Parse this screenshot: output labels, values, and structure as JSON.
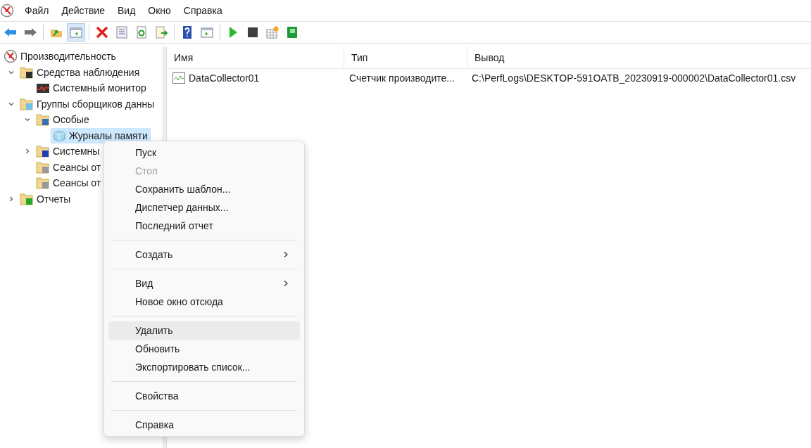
{
  "menu_bar": [
    "Файл",
    "Действие",
    "Вид",
    "Окно",
    "Справка"
  ],
  "toolbar": [
    [
      {
        "kind": "back",
        "disabled": false,
        "pressed": false
      },
      {
        "kind": "forward",
        "disabled": true,
        "pressed": false
      }
    ],
    [
      {
        "kind": "up",
        "disabled": false,
        "pressed": false
      },
      {
        "kind": "tree",
        "disabled": false,
        "pressed": true
      }
    ],
    [
      {
        "kind": "delete",
        "disabled": false,
        "pressed": false
      },
      {
        "kind": "properties",
        "disabled": false,
        "pressed": false
      },
      {
        "kind": "refresh",
        "disabled": false,
        "pressed": false
      },
      {
        "kind": "export",
        "disabled": false,
        "pressed": false
      }
    ],
    [
      {
        "kind": "help",
        "disabled": false,
        "pressed": false
      },
      {
        "kind": "pane",
        "disabled": false,
        "pressed": false
      }
    ],
    [
      {
        "kind": "play",
        "disabled": false,
        "pressed": false
      },
      {
        "kind": "stop",
        "disabled": true,
        "pressed": false
      },
      {
        "kind": "new",
        "disabled": false,
        "pressed": false
      },
      {
        "kind": "book",
        "disabled": false,
        "pressed": false
      }
    ]
  ],
  "tree": [
    {
      "label": "Производительность",
      "kind": "perf",
      "selected": false,
      "children": [
        {
          "label": "Средства наблюдения",
          "kind": "folder-monitor",
          "expanded": true,
          "selected": false,
          "children": [
            {
              "label": "Системный монитор",
              "kind": "monitor",
              "selected": false
            }
          ]
        },
        {
          "label": "Группы сборщиков данны",
          "kind": "folder-group",
          "expanded": true,
          "selected": false,
          "children": [
            {
              "label": "Особые",
              "kind": "folder-user",
              "expanded": true,
              "selected": false,
              "children": [
                {
                  "label": "Журналы памяти",
                  "kind": "cube",
                  "selected": true
                }
              ]
            },
            {
              "label": "Системны",
              "kind": "folder-system",
              "expanded": false,
              "selected": false
            },
            {
              "label": "Сеансы от",
              "kind": "folder-trace",
              "selected": false
            },
            {
              "label": "Сеансы от",
              "kind": "folder-trace",
              "selected": false
            }
          ]
        },
        {
          "label": "Отчеты",
          "kind": "folder-report",
          "expanded": false,
          "selected": false
        }
      ]
    }
  ],
  "table": {
    "columns": [
      "Имя",
      "Тип",
      "Вывод"
    ],
    "rows": [
      [
        "DataCollector01",
        "Счетчик производите...",
        "C:\\PerfLogs\\DESKTOP-591OATB_20230919-000002\\DataCollector01.csv"
      ]
    ]
  },
  "context_menu": [
    {
      "kind": "item",
      "label": "Пуск",
      "disabled": false,
      "selected": false,
      "submenu": false
    },
    {
      "kind": "item",
      "label": "Стоп",
      "disabled": true,
      "selected": false,
      "submenu": false
    },
    {
      "kind": "item",
      "label": "Сохранить шаблон...",
      "disabled": false,
      "selected": false,
      "submenu": false
    },
    {
      "kind": "item",
      "label": "Диспетчер данных...",
      "disabled": false,
      "selected": false,
      "submenu": false
    },
    {
      "kind": "item",
      "label": "Последний отчет",
      "disabled": false,
      "selected": false,
      "submenu": false
    },
    {
      "kind": "separator"
    },
    {
      "kind": "item",
      "label": "Создать",
      "disabled": false,
      "selected": false,
      "submenu": true
    },
    {
      "kind": "separator"
    },
    {
      "kind": "item",
      "label": "Вид",
      "disabled": false,
      "selected": false,
      "submenu": true
    },
    {
      "kind": "item",
      "label": "Новое окно отсюда",
      "disabled": false,
      "selected": false,
      "submenu": false
    },
    {
      "kind": "separator"
    },
    {
      "kind": "item",
      "label": "Удалить",
      "disabled": false,
      "selected": true,
      "submenu": false
    },
    {
      "kind": "item",
      "label": "Обновить",
      "disabled": false,
      "selected": false,
      "submenu": false
    },
    {
      "kind": "item",
      "label": "Экспортировать список...",
      "disabled": false,
      "selected": false,
      "submenu": false
    },
    {
      "kind": "separator"
    },
    {
      "kind": "item",
      "label": "Свойства",
      "disabled": false,
      "selected": false,
      "submenu": false
    },
    {
      "kind": "separator"
    },
    {
      "kind": "item",
      "label": "Справка",
      "disabled": false,
      "selected": false,
      "submenu": false
    }
  ]
}
